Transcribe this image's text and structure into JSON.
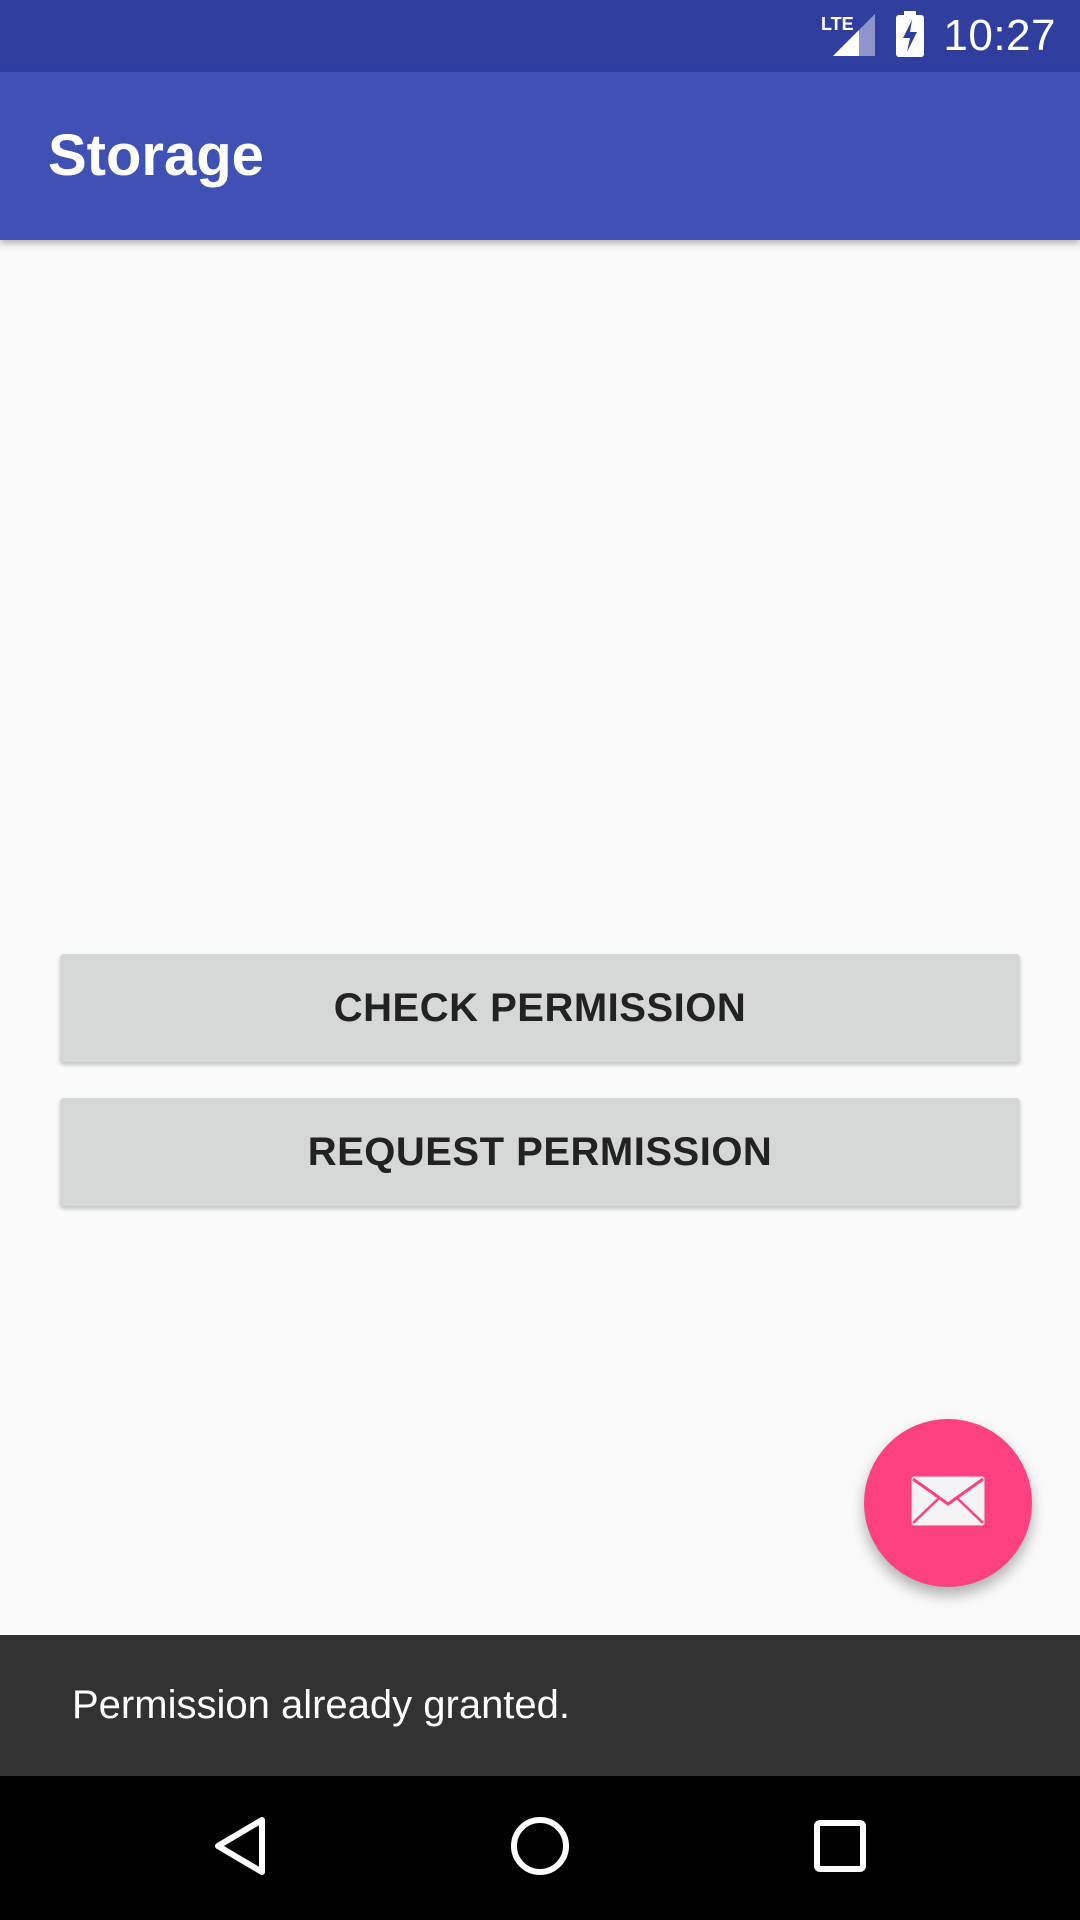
{
  "status_bar": {
    "time": "10:27",
    "network_label": "LTE",
    "icons": [
      "lte-signal-icon",
      "battery-charging-icon"
    ],
    "background_color": "#303f9f"
  },
  "app_bar": {
    "title": "Storage",
    "background_color": "#3f51b5"
  },
  "buttons": {
    "check_permission": "CHECK PERMISSION",
    "request_permission": "REQUEST PERMISSION"
  },
  "fab": {
    "icon": "mail-icon",
    "color": "#ff4081"
  },
  "snackbar": {
    "message": "Permission already granted."
  },
  "nav_bar": {
    "icons": [
      "back-icon",
      "home-icon",
      "recents-icon"
    ]
  }
}
